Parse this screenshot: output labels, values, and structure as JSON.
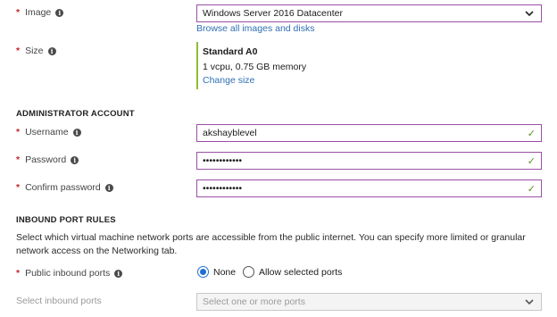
{
  "image": {
    "label": "Image",
    "value": "Windows Server 2016 Datacenter",
    "browse_link": "Browse all images and disks"
  },
  "size": {
    "label": "Size",
    "name": "Standard A0",
    "spec": "1 vcpu, 0.75 GB memory",
    "change_link": "Change size"
  },
  "admin": {
    "section_title": "ADMINISTRATOR ACCOUNT",
    "username_label": "Username",
    "username_value": "akshayblevel",
    "password_label": "Password",
    "password_value": "••••••••••••",
    "confirm_label": "Confirm password",
    "confirm_value": "••••••••••••"
  },
  "inbound": {
    "section_title": "INBOUND PORT RULES",
    "description": "Select which virtual machine network ports are accessible from the public internet. You can specify more limited or granular network access on the Networking tab.",
    "public_label": "Public inbound ports",
    "option_none": "None",
    "option_allow": "Allow selected ports",
    "selected_option": "None",
    "select_label": "Select inbound ports",
    "select_placeholder": "Select one or more ports"
  },
  "colors": {
    "focus_border": "#9b4fa7",
    "valid_check": "#5c8e22",
    "link": "#2f6fb3",
    "required": "#c4262e",
    "radio_selected": "#1f6fd1",
    "size_accent": "#8dbf2e"
  },
  "icons": [
    "info-icon",
    "chevron-down-icon",
    "checkmark-icon",
    "radio-button"
  ]
}
